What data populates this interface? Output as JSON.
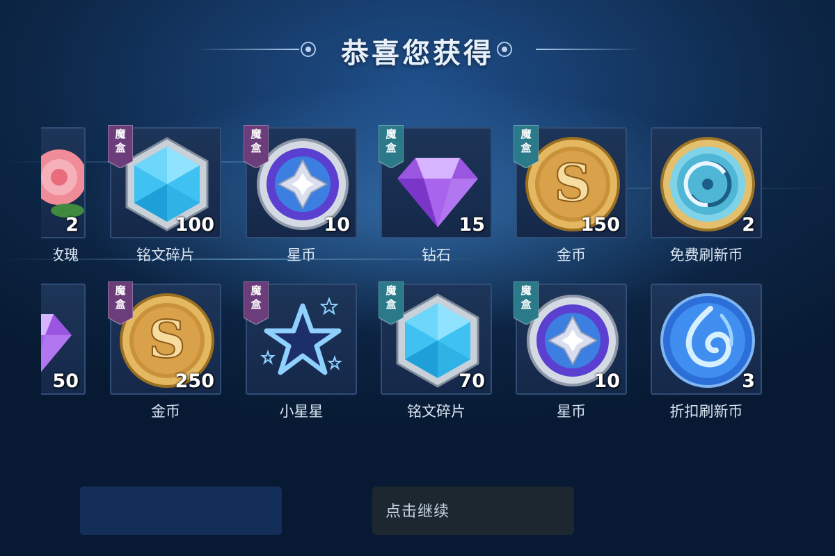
{
  "title": "恭喜您获得",
  "continue_text": "点击继续",
  "badge_text": [
    "魔",
    "盒"
  ],
  "colors": {
    "badge_purple": "#6b3d7a",
    "badge_teal": "#2a7a8a"
  },
  "rows": [
    [
      {
        "name": "玫瑰",
        "qty": "2",
        "icon": "rose-icon",
        "badge": "",
        "partial": true
      },
      {
        "name": "铭文碎片",
        "qty": "100",
        "icon": "hex-crystal-icon",
        "badge": "purple"
      },
      {
        "name": "星币",
        "qty": "10",
        "icon": "star-coin-icon",
        "badge": "purple"
      },
      {
        "name": "钻石",
        "qty": "15",
        "icon": "diamond-icon",
        "badge": "teal"
      },
      {
        "name": "金币",
        "qty": "150",
        "icon": "gold-coin-icon",
        "badge": "teal"
      },
      {
        "name": "免费刷新币",
        "qty": "2",
        "icon": "free-refresh-coin-icon",
        "badge": ""
      }
    ],
    [
      {
        "name": "",
        "qty": "50",
        "icon": "diamond-icon",
        "badge": "",
        "partial": true
      },
      {
        "name": "金币",
        "qty": "250",
        "icon": "gold-coin-icon",
        "badge": "purple"
      },
      {
        "name": "小星星",
        "qty": "",
        "icon": "small-star-icon",
        "badge": "purple"
      },
      {
        "name": "铭文碎片",
        "qty": "70",
        "icon": "hex-crystal-icon",
        "badge": "teal"
      },
      {
        "name": "星币",
        "qty": "10",
        "icon": "star-coin-icon",
        "badge": "teal"
      },
      {
        "name": "折扣刷新币",
        "qty": "3",
        "icon": "discount-refresh-coin-icon",
        "badge": ""
      }
    ]
  ]
}
